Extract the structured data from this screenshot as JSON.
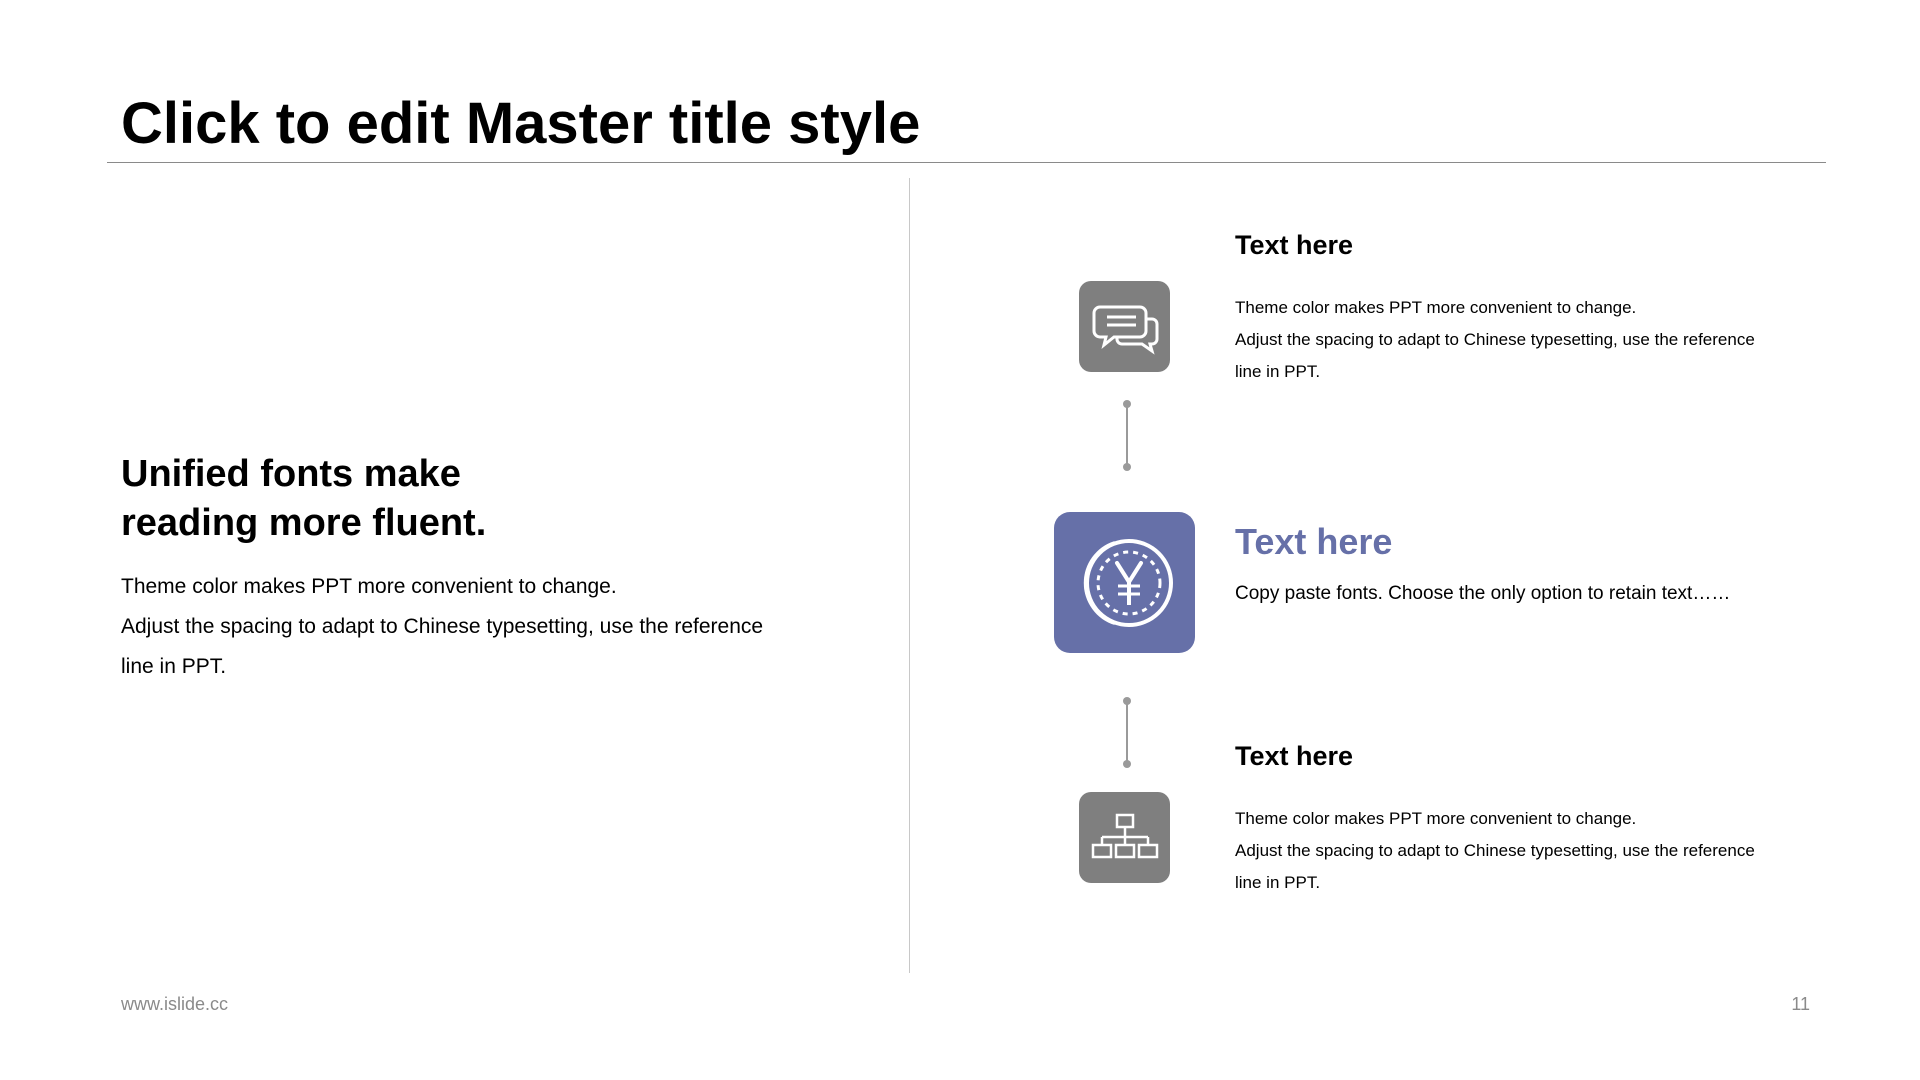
{
  "slide": {
    "title": "Click to edit Master title style"
  },
  "left_panel": {
    "heading_lines": [
      "Unified fonts make",
      "reading more fluent."
    ],
    "body_lines": [
      "Theme color makes PPT more convenient to change.",
      "Adjust the spacing to adapt to Chinese typesetting, use the reference",
      "line in PPT."
    ]
  },
  "items": [
    {
      "icon": "chat-bubbles-icon",
      "title": "Text here",
      "body_lines": [
        "Theme color makes PPT more convenient to change.",
        "Adjust the spacing to adapt to Chinese typesetting, use the reference",
        "line in PPT."
      ]
    },
    {
      "icon": "yen-coin-icon",
      "title": "Text here",
      "body_lines": [
        "Copy paste fonts. Choose the only option to retain text……"
      ]
    },
    {
      "icon": "org-chart-icon",
      "title": "Text here",
      "body_lines": [
        "Theme color makes PPT more convenient to change.",
        "Adjust the spacing to adapt to Chinese typesetting, use the reference",
        "line in PPT."
      ]
    }
  ],
  "footer": {
    "url": "www.islide.cc",
    "page_number": "11"
  },
  "colors": {
    "accent": "#6670A8",
    "icon_gray": "#7F7F7F",
    "text": "#000000",
    "muted": "#8A8A8A",
    "rule": "#8A8A8A"
  }
}
